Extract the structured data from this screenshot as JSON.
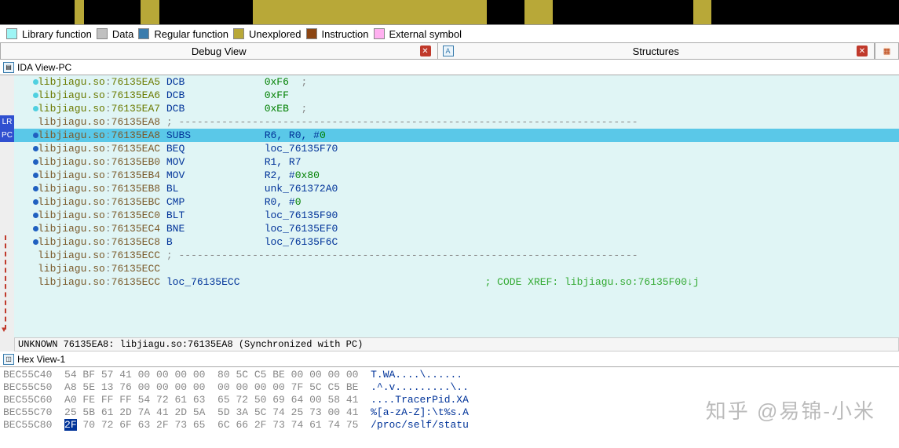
{
  "overview": {
    "segments": [
      {
        "color": "#000",
        "flex": 8
      },
      {
        "color": "#b8a838",
        "flex": 1
      },
      {
        "color": "#000",
        "flex": 6
      },
      {
        "color": "#b8a838",
        "flex": 2
      },
      {
        "color": "#000",
        "flex": 10
      },
      {
        "color": "#b8a838",
        "flex": 25
      },
      {
        "color": "#000",
        "flex": 4
      },
      {
        "color": "#b8a838",
        "flex": 3
      },
      {
        "color": "#000",
        "flex": 15
      },
      {
        "color": "#b8a838",
        "flex": 2
      },
      {
        "color": "#000",
        "flex": 20
      }
    ]
  },
  "legend": [
    {
      "color": "#9ef5f5",
      "label": "Library function"
    },
    {
      "color": "#c0c0c0",
      "label": "Data"
    },
    {
      "color": "#3a7cad",
      "label": "Regular function"
    },
    {
      "color": "#b8a838",
      "label": "Unexplored"
    },
    {
      "color": "#8b4513",
      "label": "Instruction"
    },
    {
      "color": "#ffb0f0",
      "label": "External symbol"
    }
  ],
  "tabs": {
    "left": "Debug View",
    "right": "Structures"
  },
  "ida_view": {
    "title": "IDA View-PC",
    "rows": [
      {
        "prefix": "libjiagu.so",
        "addr": "76135EA5",
        "mnem": "DCB",
        "op": "0xF6",
        "tail": "  ;",
        "dot": "cyan",
        "pcolor": "olive"
      },
      {
        "prefix": "libjiagu.so",
        "addr": "76135EA6",
        "mnem": "DCB",
        "op": "0xFF",
        "tail": "",
        "dot": "cyan",
        "pcolor": "olive"
      },
      {
        "prefix": "libjiagu.so",
        "addr": "76135EA7",
        "mnem": "DCB",
        "op": "0xEB",
        "tail": "  ;",
        "dot": "cyan",
        "pcolor": "olive"
      },
      {
        "prefix": "libjiagu.so",
        "addr": "76135EA8",
        "sep": true,
        "pcolor": "brown"
      },
      {
        "prefix": "libjiagu.so",
        "addr": "76135EA8",
        "mnem": "SUBS",
        "ops": [
          {
            "t": "R6, R0, ",
            "c": "navy"
          },
          {
            "t": "#",
            "c": "navy"
          },
          {
            "t": "0",
            "c": "green"
          }
        ],
        "dot": "blue",
        "hl": true,
        "pcolor": "brown",
        "badge": "PC"
      },
      {
        "prefix": "libjiagu.so",
        "addr": "76135EAC",
        "mnem": "BEQ",
        "ops": [
          {
            "t": "loc_76135F70",
            "c": "navy"
          }
        ],
        "dot": "blue",
        "pcolor": "brown"
      },
      {
        "prefix": "libjiagu.so",
        "addr": "76135EB0",
        "mnem": "MOV",
        "ops": [
          {
            "t": "R1, R7",
            "c": "navy"
          }
        ],
        "dot": "blue",
        "pcolor": "brown"
      },
      {
        "prefix": "libjiagu.so",
        "addr": "76135EB4",
        "mnem": "MOV",
        "ops": [
          {
            "t": "R2, ",
            "c": "navy"
          },
          {
            "t": "#",
            "c": "navy"
          },
          {
            "t": "0x80",
            "c": "green"
          }
        ],
        "dot": "blue",
        "pcolor": "brown"
      },
      {
        "prefix": "libjiagu.so",
        "addr": "76135EB8",
        "mnem": "BL",
        "ops": [
          {
            "t": "unk_761372A0",
            "c": "navy"
          }
        ],
        "dot": "blue",
        "pcolor": "brown"
      },
      {
        "prefix": "libjiagu.so",
        "addr": "76135EBC",
        "mnem": "CMP",
        "ops": [
          {
            "t": "R0, ",
            "c": "navy"
          },
          {
            "t": "#",
            "c": "navy"
          },
          {
            "t": "0",
            "c": "green"
          }
        ],
        "dot": "blue",
        "pcolor": "brown"
      },
      {
        "prefix": "libjiagu.so",
        "addr": "76135EC0",
        "mnem": "BLT",
        "ops": [
          {
            "t": "loc_76135F90",
            "c": "navy"
          }
        ],
        "dot": "blue",
        "pcolor": "brown"
      },
      {
        "prefix": "libjiagu.so",
        "addr": "76135EC4",
        "mnem": "BNE",
        "ops": [
          {
            "t": "loc_76135EF0",
            "c": "navy"
          }
        ],
        "dot": "blue",
        "pcolor": "brown"
      },
      {
        "prefix": "libjiagu.so",
        "addr": "76135EC8",
        "mnem": "B",
        "ops": [
          {
            "t": "loc_76135F6C",
            "c": "navy"
          }
        ],
        "dot": "blue",
        "pcolor": "brown"
      },
      {
        "prefix": "libjiagu.so",
        "addr": "76135ECC",
        "sep": true,
        "pcolor": "brown"
      },
      {
        "prefix": "libjiagu.so",
        "addr": "76135ECC",
        "pcolor": "brown",
        "blank": true
      },
      {
        "prefix": "libjiagu.so",
        "addr": "76135ECC",
        "label": "loc_76135ECC",
        "xref": "; CODE XREF: libjiagu.so:76135F00↓j",
        "pcolor": "brown"
      }
    ],
    "status": "UNKNOWN 76135EA8: libjiagu.so:76135EA8 (Synchronized with PC)",
    "lr_badge": "LR"
  },
  "hex_view": {
    "title": "Hex View-1",
    "rows": [
      {
        "addr": "BEC55C40",
        "b1": "54 BF 57 41 00 00 00 00",
        "b2": "80 5C C5 BE 00 00 00 00",
        "ascii": "T.WA....\\......"
      },
      {
        "addr": "BEC55C50",
        "b1": "A8 5E 13 76 00 00 00 00",
        "b2": "00 00 00 00 7F 5C C5 BE",
        "ascii": ".^.v.........\\.."
      },
      {
        "addr": "BEC55C60",
        "b1": "A0 FE FF FF 54 72 61 63",
        "b2": "65 72 50 69 64 00 58 41",
        "ascii": "....TracerPid.XA"
      },
      {
        "addr": "BEC55C70",
        "b1": "25 5B 61 2D 7A 41 2D 5A",
        "b2": "5D 3A 5C 74 25 73 00 41",
        "ascii": "%[a-zA-Z]:\\t%s.A"
      },
      {
        "addr": "BEC55C80",
        "b1_hl": "2F",
        "b1_rest": " 70 72 6F 63 2F 73 65",
        "b2": "6C 66 2F 73 74 61 74 75",
        "ascii": "/proc/self/statu",
        "hl": true
      }
    ]
  },
  "watermark": "知乎 @易锦-小米"
}
